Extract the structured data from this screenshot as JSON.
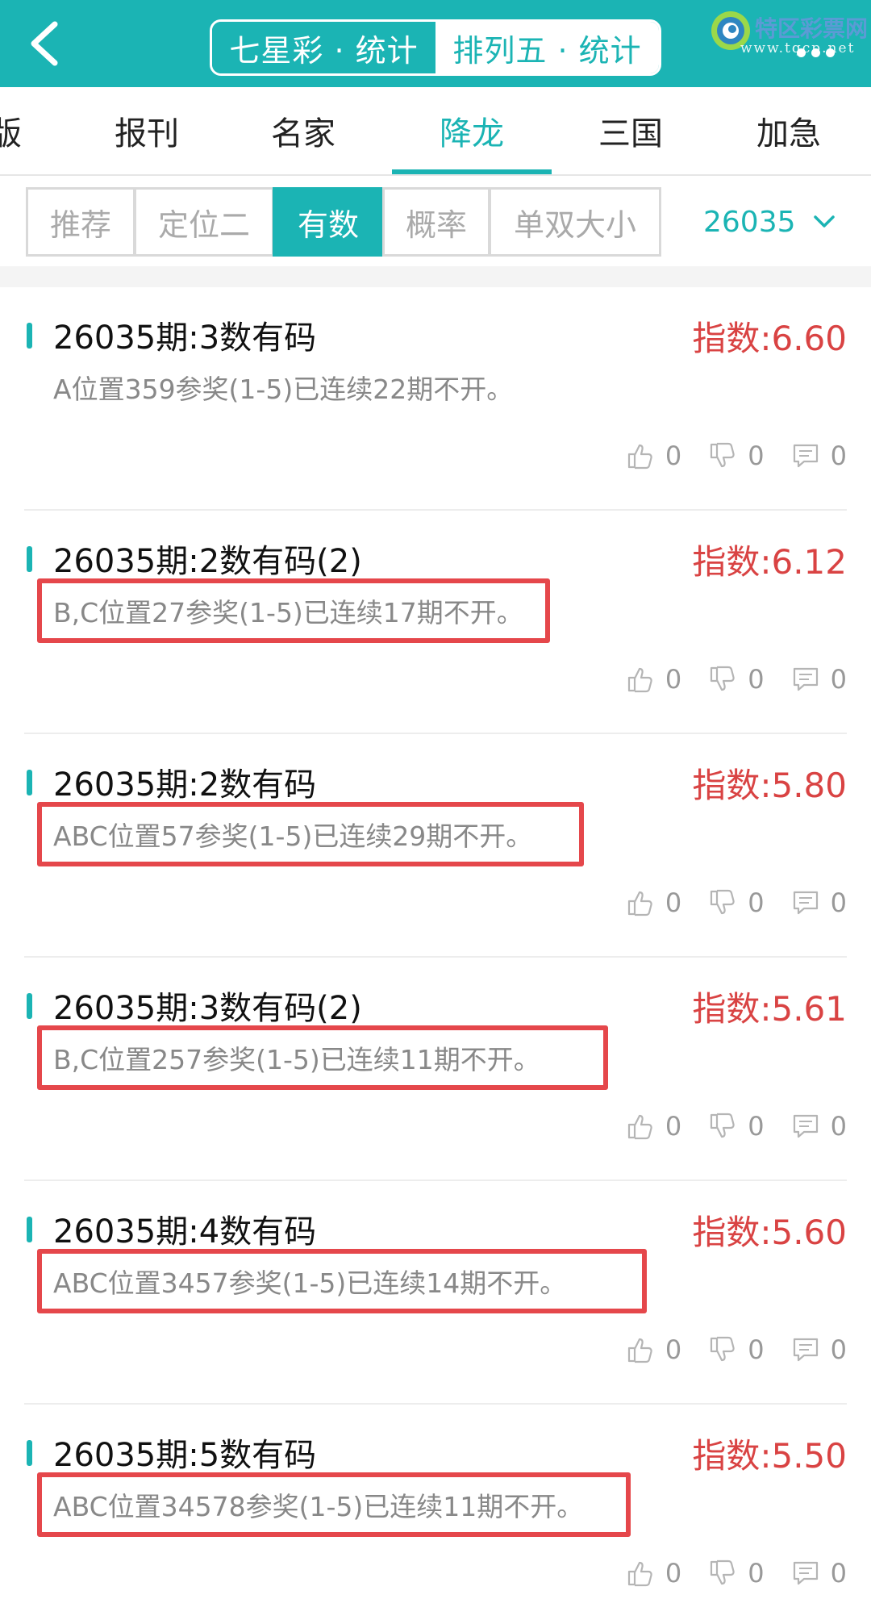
{
  "header": {
    "tab_left": "七星彩 · 统计",
    "tab_right": "排列五 · 统计",
    "logo_name": "特区彩票网",
    "logo_url": "www.tqcp.net"
  },
  "categories": [
    "版",
    "报刊",
    "名家",
    "降龙",
    "三国",
    "加急"
  ],
  "active_category": "降龙",
  "filters": [
    "推荐",
    "定位二",
    "有数",
    "概率",
    "单双大小"
  ],
  "active_filter": "有数",
  "issue_selector": "26035",
  "records": [
    {
      "title": "26035期:3数有码",
      "score": "指数:6.60",
      "desc": "A位置359参奖(1-5)已连续22期不开。",
      "highlighted": false,
      "likes": "0",
      "dislikes": "0",
      "comments": "0"
    },
    {
      "title": "26035期:2数有码(2)",
      "score": "指数:6.12",
      "desc": "B,C位置27参奖(1-5)已连续17期不开。",
      "highlighted": true,
      "likes": "0",
      "dislikes": "0",
      "comments": "0"
    },
    {
      "title": "26035期:2数有码",
      "score": "指数:5.80",
      "desc": "ABC位置57参奖(1-5)已连续29期不开。",
      "highlighted": true,
      "likes": "0",
      "dislikes": "0",
      "comments": "0"
    },
    {
      "title": "26035期:3数有码(2)",
      "score": "指数:5.61",
      "desc": "B,C位置257参奖(1-5)已连续11期不开。",
      "highlighted": true,
      "likes": "0",
      "dislikes": "0",
      "comments": "0"
    },
    {
      "title": "26035期:4数有码",
      "score": "指数:5.60",
      "desc": "ABC位置3457参奖(1-5)已连续14期不开。",
      "highlighted": true,
      "likes": "0",
      "dislikes": "0",
      "comments": "0"
    },
    {
      "title": "26035期:5数有码",
      "score": "指数:5.50",
      "desc": "ABC位置34578参奖(1-5)已连续11期不开。",
      "highlighted": true,
      "likes": "0",
      "dislikes": "0",
      "comments": "0"
    }
  ],
  "colors": {
    "accent": "#1bb4b4",
    "score": "#d94343",
    "highlight_box": "#e5474b"
  }
}
